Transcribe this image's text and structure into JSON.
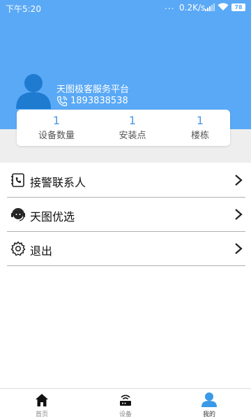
{
  "status_bar": {
    "time": "下午5:20",
    "dots": "...",
    "network_speed": "0.2K/s",
    "battery": "78"
  },
  "profile": {
    "org_name": "天图极客服务平台",
    "phone": "1893838538"
  },
  "stats": [
    {
      "value": "1",
      "label": "设备数量"
    },
    {
      "value": "1",
      "label": "安装点"
    },
    {
      "value": "1",
      "label": "楼栋"
    }
  ],
  "menu": [
    {
      "label": "接警联系人",
      "icon": "contacts-icon"
    },
    {
      "label": "天图优选",
      "icon": "customer-service-icon"
    },
    {
      "label": "退出",
      "icon": "gear-icon"
    }
  ],
  "bottom_nav": [
    {
      "label": "首页",
      "icon": "home-icon"
    },
    {
      "label": "设备",
      "icon": "router-icon"
    },
    {
      "label": "我的",
      "icon": "user-icon",
      "active": true
    }
  ],
  "colors": {
    "header": "#5aa9f6",
    "accent": "#4a98e8",
    "active_nav_icon": "#3a9ae8"
  }
}
